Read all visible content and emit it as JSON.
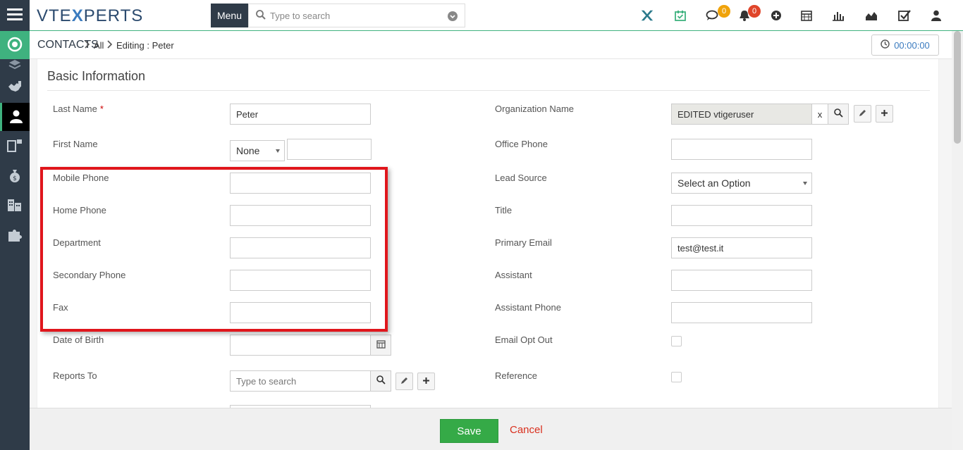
{
  "colors": {
    "accent": "#3fb27f",
    "sidebar": "#2f3b48",
    "highlight": "#e0161c",
    "save": "#35aa47",
    "cancel": "#d9301e",
    "badge_orange": "#f0a30a",
    "badge_red": "#e0452a"
  },
  "header": {
    "logo_left": "VTE",
    "logo_x": "X",
    "logo_right": "PERTS",
    "menu_label": "Menu",
    "search_placeholder": "Type to search",
    "chat_badge": "0",
    "notification_badge": "0"
  },
  "sidebar": {
    "icons": [
      "menu-icon",
      "home-icon",
      "layers-icon",
      "handshake-icon",
      "contacts-icon",
      "devices-icon",
      "money-bag-icon",
      "building-icon",
      "puzzle-icon"
    ]
  },
  "breadcrumb": {
    "module": "CONTACTS",
    "filter": "All",
    "mode": "Editing : Peter"
  },
  "timer": {
    "value": "00:00:00"
  },
  "form": {
    "block_title": "Basic Information",
    "left": {
      "last_name": {
        "label": "Last Name",
        "required": "*",
        "value": "Peter"
      },
      "first_name": {
        "label": "First Name",
        "salutation": "None",
        "value": ""
      },
      "mobile_phone": {
        "label": "Mobile Phone",
        "value": ""
      },
      "home_phone": {
        "label": "Home Phone",
        "value": ""
      },
      "department": {
        "label": "Department",
        "value": ""
      },
      "secondary_phone": {
        "label": "Secondary Phone",
        "value": ""
      },
      "fax": {
        "label": "Fax",
        "value": ""
      },
      "date_of_birth": {
        "label": "Date of Birth",
        "value": ""
      },
      "reports_to": {
        "label": "Reports To",
        "placeholder": "Type to search"
      }
    },
    "right": {
      "organization_name": {
        "label": "Organization Name",
        "value": "EDITED vtigeruser",
        "clear": "x"
      },
      "office_phone": {
        "label": "Office Phone",
        "value": ""
      },
      "lead_source": {
        "label": "Lead Source",
        "value": "Select an Option"
      },
      "title": {
        "label": "Title",
        "value": ""
      },
      "primary_email": {
        "label": "Primary Email",
        "value": "test@test.it"
      },
      "assistant": {
        "label": "Assistant",
        "value": ""
      },
      "assistant_phone": {
        "label": "Assistant Phone",
        "value": ""
      },
      "email_opt_out": {
        "label": "Email Opt Out",
        "checked": false
      },
      "reference": {
        "label": "Reference",
        "checked": false
      }
    }
  },
  "footer": {
    "save_label": "Save",
    "cancel_label": "Cancel"
  }
}
